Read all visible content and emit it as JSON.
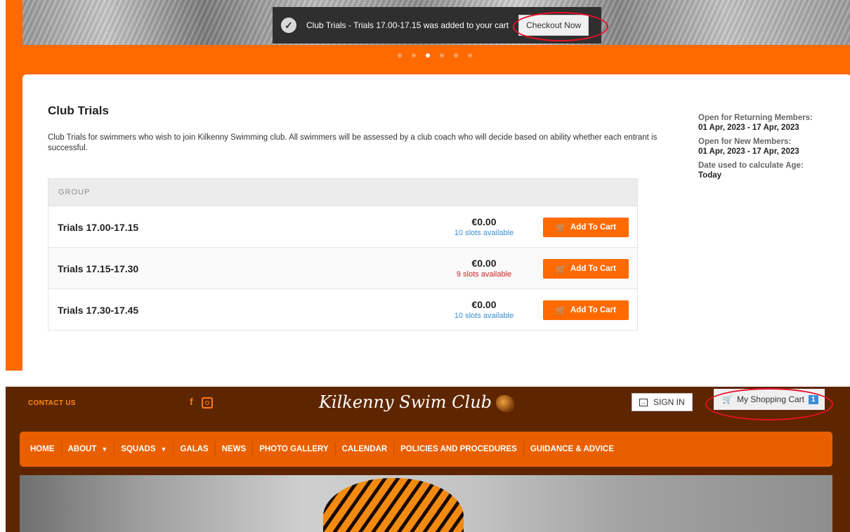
{
  "toast": {
    "message": "Club Trials - Trials 17.00-17.15 was added to your cart",
    "checkout_label": "Checkout Now"
  },
  "event": {
    "title": "Club Trials",
    "description": "Club Trials for swimmers who wish to join Kilkenny Swimming club. All swimmers will be assessed by a club coach who will decide based on ability whether each entrant is successful."
  },
  "table": {
    "header": "GROUP",
    "rows": [
      {
        "name": "Trials 17.00-17.15",
        "price": "€0.00",
        "slots": "10 slots available",
        "slots_color": "#3a8fd0",
        "button": "Add To Cart"
      },
      {
        "name": "Trials 17.15-17.30",
        "price": "€0.00",
        "slots": "9 slots available",
        "slots_color": "#d42020",
        "button": "Add To Cart"
      },
      {
        "name": "Trials 17.30-17.45",
        "price": "€0.00",
        "slots": "10 slots available",
        "slots_color": "#3a8fd0",
        "button": "Add To Cart"
      }
    ]
  },
  "info": {
    "returning_label": "Open for Returning Members:",
    "returning_value": "01 Apr, 2023 - 17 Apr, 2023",
    "new_label": "Open for New Members:",
    "new_value": "01 Apr, 2023 - 17 Apr, 2023",
    "age_label": "Date used to calculate Age:",
    "age_value": "Today"
  },
  "header": {
    "contact": "CONTACT US",
    "site_title": "Kilkenny Swim Club",
    "sign_in": "SIGN IN",
    "cart_label": "My Shopping Cart",
    "cart_count": "1",
    "facebook_glyph": "f"
  },
  "nav": {
    "home": "HOME",
    "about": "ABOUT",
    "squads": "SQUADS",
    "galas": "GALAS",
    "news": "NEWS",
    "gallery": "PHOTO GALLERY",
    "calendar": "CALENDAR",
    "policies": "POLICIES AND PROCEDURES",
    "guidance": "GUIDANCE & ADVICE"
  },
  "colors": {
    "accent": "#ff6a00",
    "header_bg": "#5e2600",
    "nav_bg": "#e95f00",
    "highlight_oval": "#e8102a"
  },
  "slider": {
    "dot_count": 6,
    "active_dot": 3
  }
}
